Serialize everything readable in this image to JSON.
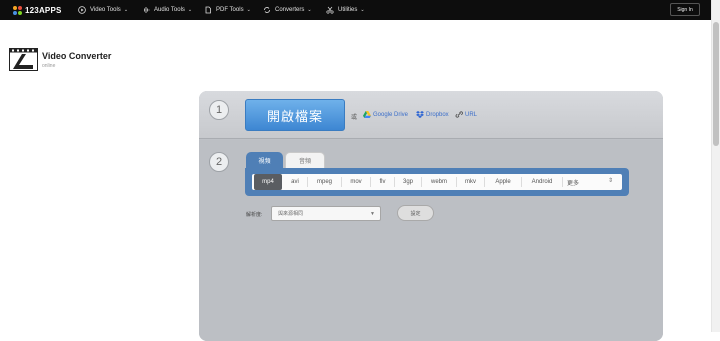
{
  "topnav": {
    "brand": "123APPS",
    "items": [
      {
        "label": "Video Tools",
        "icon": "play-circle-icon"
      },
      {
        "label": "Audio Tools",
        "icon": "waveform-icon"
      },
      {
        "label": "PDF Tools",
        "icon": "document-icon"
      },
      {
        "label": "Converters",
        "icon": "convert-icon"
      },
      {
        "label": "Utilities",
        "icon": "scissors-icon"
      }
    ],
    "signin": "Sign In"
  },
  "app": {
    "title": "Video Converter",
    "subtitle": "online"
  },
  "step1": {
    "number": "1",
    "open_button": "開啟檔案",
    "or_text": "或",
    "sources": [
      {
        "label": "Google Drive",
        "icon": "google-drive-icon"
      },
      {
        "label": "Dropbox",
        "icon": "dropbox-icon"
      },
      {
        "label": "URL",
        "icon": "link-icon"
      }
    ]
  },
  "step2": {
    "number": "2",
    "tabs": [
      "視頻",
      "音頻"
    ],
    "formats": [
      "mp4",
      "avi",
      "mpeg",
      "mov",
      "flv",
      "3gp",
      "webm",
      "mkv",
      "Apple",
      "Android",
      "更多"
    ],
    "selected_format": "mp4",
    "resolution_label": "解析度:",
    "resolution_value": "與來源相同",
    "settings_button": "設定"
  },
  "colors": {
    "nav_bg": "#0d0d0d",
    "accent_blue": "#4f7fb6",
    "open_button": "#4a92de",
    "panel_gray": "#bcbfc4"
  }
}
